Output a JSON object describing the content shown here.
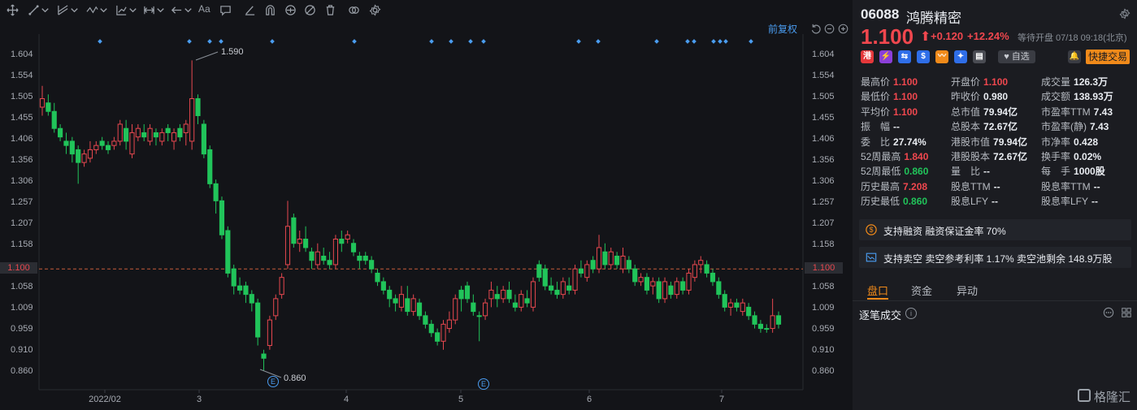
{
  "chart_pane": {
    "restore_label": "前复权",
    "toolbar_text": "Aa",
    "price_tag": "1.100",
    "y_axis_ticks": [
      "1.604",
      "1.554",
      "1.505",
      "1.455",
      "1.406",
      "1.356",
      "1.306",
      "1.257",
      "1.207",
      "1.158",
      "1.058",
      "1.009",
      "0.959",
      "0.910",
      "0.860"
    ],
    "x_axis_ticks": [
      "2022/02",
      "3",
      "4",
      "5",
      "6",
      "7"
    ],
    "high_annotation": "1.590",
    "low_annotation": "0.860",
    "event_marker": "E",
    "colors": {
      "up": "#e7484f",
      "down": "#21c45a",
      "dots": "#4a9cf0",
      "dashed": "#c65a3a"
    }
  },
  "chart_data": {
    "type": "candlestick",
    "y_axis_ticks": [
      1.604,
      1.554,
      1.505,
      1.455,
      1.406,
      1.356,
      1.306,
      1.257,
      1.207,
      1.158,
      1.108,
      1.058,
      1.009,
      0.959,
      0.91,
      0.86
    ],
    "reference_line": 1.1,
    "x_ticks": [
      "2022/02",
      "3",
      "4",
      "5",
      "6",
      "7"
    ],
    "high_annotation": 1.59,
    "low_annotation": 0.86,
    "candles": [
      {
        "o": 1.48,
        "h": 1.53,
        "l": 1.46,
        "c": 1.5,
        "up": true
      },
      {
        "o": 1.49,
        "h": 1.51,
        "l": 1.46,
        "c": 1.47,
        "up": false
      },
      {
        "o": 1.47,
        "h": 1.49,
        "l": 1.42,
        "c": 1.43,
        "up": false
      },
      {
        "o": 1.43,
        "h": 1.44,
        "l": 1.4,
        "c": 1.41,
        "up": false
      },
      {
        "o": 1.4,
        "h": 1.42,
        "l": 1.37,
        "c": 1.39,
        "up": false
      },
      {
        "o": 1.4,
        "h": 1.41,
        "l": 1.35,
        "c": 1.37,
        "up": false
      },
      {
        "o": 1.38,
        "h": 1.39,
        "l": 1.3,
        "c": 1.35,
        "up": false
      },
      {
        "o": 1.35,
        "h": 1.38,
        "l": 1.34,
        "c": 1.37,
        "up": true
      },
      {
        "o": 1.36,
        "h": 1.4,
        "l": 1.35,
        "c": 1.38,
        "up": true
      },
      {
        "o": 1.38,
        "h": 1.4,
        "l": 1.37,
        "c": 1.39,
        "up": true
      },
      {
        "o": 1.4,
        "h": 1.41,
        "l": 1.38,
        "c": 1.39,
        "up": false
      },
      {
        "o": 1.39,
        "h": 1.4,
        "l": 1.37,
        "c": 1.38,
        "up": false
      },
      {
        "o": 1.4,
        "h": 1.41,
        "l": 1.38,
        "c": 1.39,
        "up": true
      },
      {
        "o": 1.4,
        "h": 1.45,
        "l": 1.39,
        "c": 1.44,
        "up": true
      },
      {
        "o": 1.43,
        "h": 1.45,
        "l": 1.38,
        "c": 1.4,
        "up": false
      },
      {
        "o": 1.37,
        "h": 1.44,
        "l": 1.36,
        "c": 1.42,
        "up": true
      },
      {
        "o": 1.41,
        "h": 1.44,
        "l": 1.4,
        "c": 1.43,
        "up": true
      },
      {
        "o": 1.42,
        "h": 1.44,
        "l": 1.4,
        "c": 1.41,
        "up": false
      },
      {
        "o": 1.4,
        "h": 1.44,
        "l": 1.39,
        "c": 1.43,
        "up": true
      },
      {
        "o": 1.42,
        "h": 1.43,
        "l": 1.39,
        "c": 1.41,
        "up": false
      },
      {
        "o": 1.4,
        "h": 1.43,
        "l": 1.39,
        "c": 1.42,
        "up": true
      },
      {
        "o": 1.42,
        "h": 1.44,
        "l": 1.4,
        "c": 1.43,
        "up": false
      },
      {
        "o": 1.4,
        "h": 1.43,
        "l": 1.38,
        "c": 1.42,
        "up": true
      },
      {
        "o": 1.43,
        "h": 1.44,
        "l": 1.4,
        "c": 1.41,
        "up": false
      },
      {
        "o": 1.42,
        "h": 1.45,
        "l": 1.39,
        "c": 1.44,
        "up": true
      },
      {
        "o": 1.4,
        "h": 1.59,
        "l": 1.38,
        "c": 1.5,
        "up": true
      },
      {
        "o": 1.5,
        "h": 1.51,
        "l": 1.44,
        "c": 1.46,
        "up": false
      },
      {
        "o": 1.44,
        "h": 1.45,
        "l": 1.36,
        "c": 1.37,
        "up": false
      },
      {
        "o": 1.38,
        "h": 1.39,
        "l": 1.29,
        "c": 1.3,
        "up": false
      },
      {
        "o": 1.3,
        "h": 1.31,
        "l": 1.23,
        "c": 1.26,
        "up": false
      },
      {
        "o": 1.26,
        "h": 1.27,
        "l": 1.17,
        "c": 1.18,
        "up": false
      },
      {
        "o": 1.19,
        "h": 1.2,
        "l": 1.08,
        "c": 1.09,
        "up": false
      },
      {
        "o": 1.1,
        "h": 1.11,
        "l": 1.04,
        "c": 1.06,
        "up": false
      },
      {
        "o": 1.06,
        "h": 1.08,
        "l": 1.04,
        "c": 1.05,
        "up": false
      },
      {
        "o": 1.06,
        "h": 1.07,
        "l": 1.02,
        "c": 1.04,
        "up": false
      },
      {
        "o": 1.04,
        "h": 1.05,
        "l": 1.0,
        "c": 1.02,
        "up": false
      },
      {
        "o": 1.02,
        "h": 1.03,
        "l": 0.92,
        "c": 0.94,
        "up": false
      },
      {
        "o": 0.9,
        "h": 0.91,
        "l": 0.86,
        "c": 0.89,
        "up": false
      },
      {
        "o": 0.92,
        "h": 0.99,
        "l": 0.91,
        "c": 0.98,
        "up": true
      },
      {
        "o": 0.99,
        "h": 1.04,
        "l": 0.98,
        "c": 1.03,
        "up": true
      },
      {
        "o": 1.04,
        "h": 1.09,
        "l": 1.03,
        "c": 1.08,
        "up": true
      },
      {
        "o": 1.11,
        "h": 1.26,
        "l": 1.1,
        "c": 1.2,
        "up": true
      },
      {
        "o": 1.22,
        "h": 1.23,
        "l": 1.15,
        "c": 1.16,
        "up": false
      },
      {
        "o": 1.16,
        "h": 1.19,
        "l": 1.14,
        "c": 1.17,
        "up": true
      },
      {
        "o": 1.17,
        "h": 1.2,
        "l": 1.14,
        "c": 1.15,
        "up": false
      },
      {
        "o": 1.14,
        "h": 1.15,
        "l": 1.1,
        "c": 1.12,
        "up": false
      },
      {
        "o": 1.11,
        "h": 1.16,
        "l": 1.1,
        "c": 1.14,
        "up": true
      },
      {
        "o": 1.13,
        "h": 1.15,
        "l": 1.11,
        "c": 1.12,
        "up": false
      },
      {
        "o": 1.12,
        "h": 1.14,
        "l": 1.1,
        "c": 1.11,
        "up": false
      },
      {
        "o": 1.11,
        "h": 1.18,
        "l": 1.1,
        "c": 1.17,
        "up": true
      },
      {
        "o": 1.17,
        "h": 1.19,
        "l": 1.14,
        "c": 1.16,
        "up": false
      },
      {
        "o": 1.17,
        "h": 1.19,
        "l": 1.16,
        "c": 1.18,
        "up": true
      },
      {
        "o": 1.16,
        "h": 1.17,
        "l": 1.13,
        "c": 1.14,
        "up": false
      },
      {
        "o": 1.13,
        "h": 1.14,
        "l": 1.1,
        "c": 1.12,
        "up": false
      },
      {
        "o": 1.13,
        "h": 1.14,
        "l": 1.11,
        "c": 1.12,
        "up": false
      },
      {
        "o": 1.12,
        "h": 1.13,
        "l": 1.09,
        "c": 1.1,
        "up": false
      },
      {
        "o": 1.09,
        "h": 1.1,
        "l": 1.06,
        "c": 1.07,
        "up": false
      },
      {
        "o": 1.07,
        "h": 1.08,
        "l": 1.04,
        "c": 1.05,
        "up": false
      },
      {
        "o": 1.05,
        "h": 1.06,
        "l": 1.01,
        "c": 1.03,
        "up": false
      },
      {
        "o": 1.03,
        "h": 1.04,
        "l": 1.0,
        "c": 1.02,
        "up": false
      },
      {
        "o": 1.01,
        "h": 1.06,
        "l": 1.0,
        "c": 1.04,
        "up": true
      },
      {
        "o": 1.03,
        "h": 1.06,
        "l": 0.99,
        "c": 1.0,
        "up": false
      },
      {
        "o": 1.0,
        "h": 1.04,
        "l": 0.99,
        "c": 1.03,
        "up": true
      },
      {
        "o": 1.02,
        "h": 1.03,
        "l": 0.98,
        "c": 0.99,
        "up": false
      },
      {
        "o": 0.99,
        "h": 1.0,
        "l": 0.96,
        "c": 0.97,
        "up": false
      },
      {
        "o": 0.97,
        "h": 0.98,
        "l": 0.94,
        "c": 0.95,
        "up": false
      },
      {
        "o": 0.95,
        "h": 0.96,
        "l": 0.92,
        "c": 0.93,
        "up": false
      },
      {
        "o": 0.93,
        "h": 0.98,
        "l": 0.91,
        "c": 0.97,
        "up": true
      },
      {
        "o": 0.96,
        "h": 1.0,
        "l": 0.95,
        "c": 0.98,
        "up": true
      },
      {
        "o": 0.98,
        "h": 1.04,
        "l": 0.97,
        "c": 1.03,
        "up": true
      },
      {
        "o": 1.03,
        "h": 1.06,
        "l": 1.0,
        "c": 1.05,
        "up": false
      },
      {
        "o": 1.06,
        "h": 1.07,
        "l": 1.02,
        "c": 1.03,
        "up": false
      },
      {
        "o": 1.02,
        "h": 1.04,
        "l": 0.99,
        "c": 1.0,
        "up": false
      },
      {
        "o": 0.99,
        "h": 1.0,
        "l": 0.93,
        "c": 0.99,
        "up": false
      },
      {
        "o": 0.99,
        "h": 1.03,
        "l": 0.98,
        "c": 1.02,
        "up": true
      },
      {
        "o": 1.03,
        "h": 1.07,
        "l": 1.01,
        "c": 1.05,
        "up": true
      },
      {
        "o": 1.04,
        "h": 1.06,
        "l": 1.01,
        "c": 1.03,
        "up": false
      },
      {
        "o": 1.03,
        "h": 1.06,
        "l": 1.02,
        "c": 1.05,
        "up": true
      },
      {
        "o": 1.05,
        "h": 1.07,
        "l": 1.02,
        "c": 1.03,
        "up": false
      },
      {
        "o": 1.02,
        "h": 1.04,
        "l": 1.0,
        "c": 1.01,
        "up": false
      },
      {
        "o": 1.01,
        "h": 1.05,
        "l": 1.0,
        "c": 1.04,
        "up": true
      },
      {
        "o": 1.03,
        "h": 1.05,
        "l": 1.01,
        "c": 1.02,
        "up": false
      },
      {
        "o": 1.01,
        "h": 1.08,
        "l": 1.0,
        "c": 1.07,
        "up": true
      },
      {
        "o": 1.08,
        "h": 1.12,
        "l": 1.07,
        "c": 1.11,
        "up": false
      },
      {
        "o": 1.1,
        "h": 1.11,
        "l": 1.05,
        "c": 1.06,
        "up": false
      },
      {
        "o": 1.06,
        "h": 1.08,
        "l": 1.04,
        "c": 1.05,
        "up": false
      },
      {
        "o": 1.05,
        "h": 1.07,
        "l": 1.03,
        "c": 1.04,
        "up": false
      },
      {
        "o": 1.04,
        "h": 1.08,
        "l": 1.03,
        "c": 1.07,
        "up": true
      },
      {
        "o": 1.06,
        "h": 1.08,
        "l": 1.04,
        "c": 1.05,
        "up": false
      },
      {
        "o": 1.05,
        "h": 1.11,
        "l": 1.04,
        "c": 1.1,
        "up": true
      },
      {
        "o": 1.1,
        "h": 1.12,
        "l": 1.08,
        "c": 1.09,
        "up": false
      },
      {
        "o": 1.08,
        "h": 1.12,
        "l": 1.07,
        "c": 1.11,
        "up": true
      },
      {
        "o": 1.12,
        "h": 1.13,
        "l": 1.09,
        "c": 1.1,
        "up": false
      },
      {
        "o": 1.1,
        "h": 1.18,
        "l": 1.09,
        "c": 1.15,
        "up": true
      },
      {
        "o": 1.14,
        "h": 1.16,
        "l": 1.1,
        "c": 1.11,
        "up": false
      },
      {
        "o": 1.11,
        "h": 1.15,
        "l": 1.1,
        "c": 1.14,
        "up": true
      },
      {
        "o": 1.13,
        "h": 1.14,
        "l": 1.1,
        "c": 1.11,
        "up": false
      },
      {
        "o": 1.1,
        "h": 1.15,
        "l": 1.09,
        "c": 1.13,
        "up": true
      },
      {
        "o": 1.12,
        "h": 1.13,
        "l": 1.09,
        "c": 1.1,
        "up": false
      },
      {
        "o": 1.1,
        "h": 1.11,
        "l": 1.06,
        "c": 1.07,
        "up": false
      },
      {
        "o": 1.07,
        "h": 1.09,
        "l": 1.06,
        "c": 1.08,
        "up": true
      },
      {
        "o": 1.08,
        "h": 1.09,
        "l": 1.04,
        "c": 1.05,
        "up": false
      },
      {
        "o": 1.06,
        "h": 1.08,
        "l": 1.04,
        "c": 1.07,
        "up": true
      },
      {
        "o": 1.07,
        "h": 1.08,
        "l": 1.02,
        "c": 1.03,
        "up": false
      },
      {
        "o": 1.03,
        "h": 1.08,
        "l": 1.02,
        "c": 1.07,
        "up": true
      },
      {
        "o": 1.06,
        "h": 1.07,
        "l": 1.03,
        "c": 1.04,
        "up": false
      },
      {
        "o": 1.04,
        "h": 1.08,
        "l": 1.03,
        "c": 1.07,
        "up": true
      },
      {
        "o": 1.07,
        "h": 1.08,
        "l": 1.04,
        "c": 1.05,
        "up": false
      },
      {
        "o": 1.05,
        "h": 1.1,
        "l": 1.04,
        "c": 1.09,
        "up": true
      },
      {
        "o": 1.08,
        "h": 1.12,
        "l": 1.07,
        "c": 1.11,
        "up": true
      },
      {
        "o": 1.11,
        "h": 1.13,
        "l": 1.09,
        "c": 1.12,
        "up": true
      },
      {
        "o": 1.11,
        "h": 1.12,
        "l": 1.08,
        "c": 1.09,
        "up": false
      },
      {
        "o": 1.09,
        "h": 1.1,
        "l": 1.06,
        "c": 1.07,
        "up": false
      },
      {
        "o": 1.07,
        "h": 1.08,
        "l": 1.03,
        "c": 1.04,
        "up": false
      },
      {
        "o": 1.04,
        "h": 1.05,
        "l": 1.0,
        "c": 1.01,
        "up": false
      },
      {
        "o": 1.01,
        "h": 1.03,
        "l": 0.99,
        "c": 1.02,
        "up": true
      },
      {
        "o": 1.02,
        "h": 1.03,
        "l": 1.0,
        "c": 1.01,
        "up": false
      },
      {
        "o": 1.0,
        "h": 1.03,
        "l": 0.99,
        "c": 1.02,
        "up": true
      },
      {
        "o": 1.01,
        "h": 1.02,
        "l": 0.98,
        "c": 0.99,
        "up": false
      },
      {
        "o": 0.99,
        "h": 1.0,
        "l": 0.96,
        "c": 0.97,
        "up": false
      },
      {
        "o": 0.97,
        "h": 0.98,
        "l": 0.95,
        "c": 0.96,
        "up": false
      },
      {
        "o": 0.96,
        "h": 0.97,
        "l": 0.95,
        "c": 0.96,
        "up": false
      },
      {
        "o": 0.96,
        "h": 1.03,
        "l": 0.95,
        "c": 0.99,
        "up": true
      },
      {
        "o": 0.99,
        "h": 1.0,
        "l": 0.96,
        "c": 0.97,
        "up": false
      }
    ]
  },
  "quote": {
    "code": "06088",
    "name": "鸿腾精密",
    "price": "1.100",
    "arrow": "⬆",
    "change": "+0.120",
    "change_pct": "+12.24%",
    "status": "等待开盘 07/18 09:18(北京)",
    "favorite_label": "♥ 自选",
    "quick_trade_label": "快捷交易",
    "badges": [
      "港",
      "⚡",
      "⇆",
      "$",
      "〰",
      "✦",
      "▤"
    ],
    "badge_colors": [
      "#e5383b",
      "#8b3fd9",
      "#2f6ee8",
      "#2f6ee8",
      "#f08a1a",
      "#2f6ee8",
      "#4a4c53"
    ],
    "rows": [
      [
        {
          "label": "最高价",
          "value": "1.100",
          "tone": "up"
        },
        {
          "label": "开盘价",
          "value": "1.100",
          "tone": "up"
        },
        {
          "label": "成交量",
          "value": "126.3万",
          "tone": ""
        }
      ],
      [
        {
          "label": "最低价",
          "value": "1.100",
          "tone": "up"
        },
        {
          "label": "昨收价",
          "value": "0.980",
          "tone": ""
        },
        {
          "label": "成交额",
          "value": "138.93万",
          "tone": ""
        }
      ],
      [
        {
          "label": "平均价",
          "value": "1.100",
          "tone": "up"
        },
        {
          "label": "总市值",
          "value": "79.94亿",
          "tone": ""
        },
        {
          "label": "市盈率TTM",
          "value": "7.43",
          "tone": ""
        }
      ],
      [
        {
          "label": "振　幅",
          "value": "--",
          "tone": ""
        },
        {
          "label": "总股本",
          "value": "72.67亿",
          "tone": ""
        },
        {
          "label": "市盈率(静)",
          "value": "7.43",
          "tone": ""
        }
      ],
      [
        {
          "label": "委　比",
          "value": "27.74%",
          "tone": ""
        },
        {
          "label": "港股市值",
          "value": "79.94亿",
          "tone": ""
        },
        {
          "label": "市净率",
          "value": "0.428",
          "tone": ""
        }
      ],
      [
        {
          "label": "52周最高",
          "value": "1.840",
          "tone": "up"
        },
        {
          "label": "港股股本",
          "value": "72.67亿",
          "tone": ""
        },
        {
          "label": "换手率",
          "value": "0.02%",
          "tone": ""
        }
      ],
      [
        {
          "label": "52周最低",
          "value": "0.860",
          "tone": "down"
        },
        {
          "label": "量　比",
          "value": "--",
          "tone": ""
        },
        {
          "label": "每　手",
          "value": "1000股",
          "tone": ""
        }
      ],
      [
        {
          "label": "历史最高",
          "value": "7.208",
          "tone": "up"
        },
        {
          "label": "股息TTM",
          "value": "--",
          "tone": ""
        },
        {
          "label": "股息率TTM",
          "value": "--",
          "tone": ""
        }
      ],
      [
        {
          "label": "历史最低",
          "value": "0.860",
          "tone": "down"
        },
        {
          "label": "股息LFY",
          "value": "--",
          "tone": ""
        },
        {
          "label": "股息率LFY",
          "value": "--",
          "tone": ""
        }
      ]
    ],
    "margin_info": "支持融资  融资保证金率 70%",
    "short_info": "支持卖空  卖空参考利率 1.17%  卖空池剩余 148.9万股",
    "tabs": [
      "盘口",
      "资金",
      "异动"
    ],
    "ticks_title": "逐笔成交",
    "watermark": "格隆汇"
  }
}
